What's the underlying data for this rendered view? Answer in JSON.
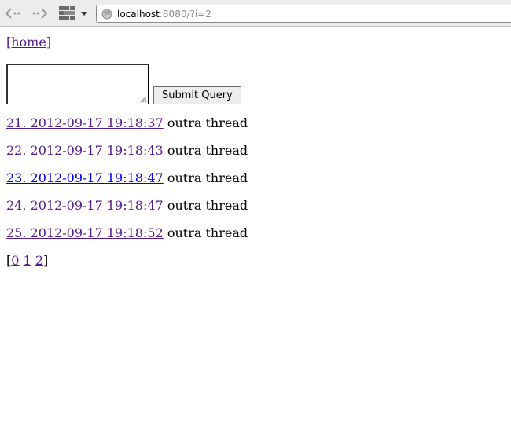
{
  "browser": {
    "url_host": "localhost",
    "url_rest": ":8080/?i=2",
    "icons": {
      "back": "back-arrow-icon",
      "forward": "forward-arrow-icon",
      "grid": "grid-view-icon",
      "dropdown": "chevron-down-icon",
      "site": "globe-icon"
    }
  },
  "page": {
    "home_link": "[home]",
    "textarea_value": "",
    "submit_label": "Submit Query",
    "threads": [
      {
        "link": "21. 2012-09-17 19:18:37",
        "title": " outra thread"
      },
      {
        "link": "22. 2012-09-17 19:18:43",
        "title": " outra thread"
      },
      {
        "link": "23. 2012-09-17 19:18:47",
        "title": " outra thread"
      },
      {
        "link": "24. 2012-09-17 19:18:47",
        "title": " outra thread"
      },
      {
        "link": "25. 2012-09-17 19:18:52",
        "title": " outra thread"
      }
    ],
    "pager": {
      "open": "[",
      "pages": [
        "0",
        "1",
        "2"
      ],
      "close": "]"
    }
  },
  "colors": {
    "visited_link": "#551a8b",
    "unvisited_link": "#0000ee"
  }
}
